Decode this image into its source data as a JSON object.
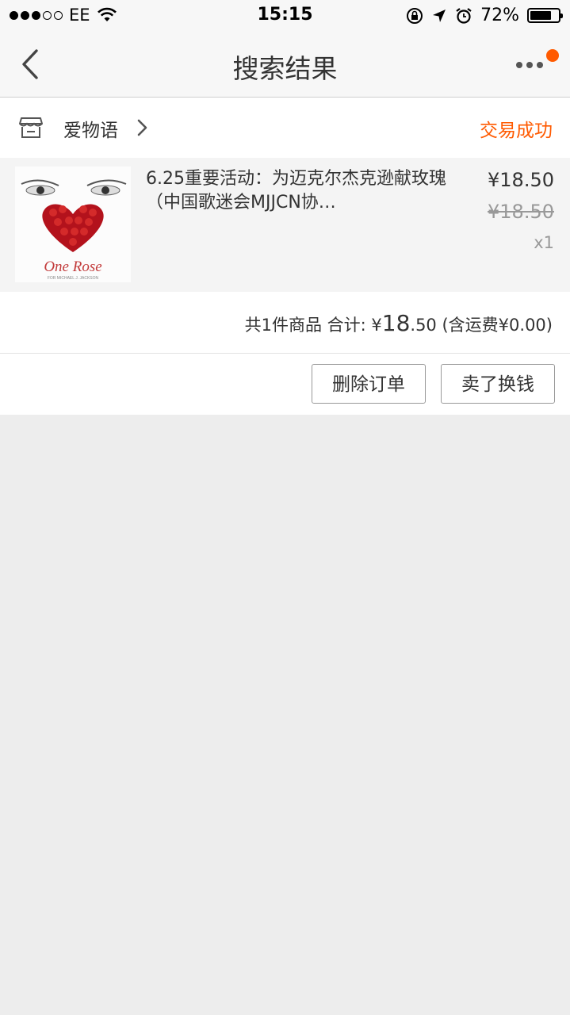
{
  "status_bar": {
    "carrier": "EE",
    "time": "15:15",
    "battery": "72%"
  },
  "nav": {
    "title": "搜索结果"
  },
  "order": {
    "shop_name": "爱物语",
    "status": "交易成功",
    "item": {
      "title": "6.25重要活动：为迈克尔杰克逊献玫瑰 （中国歌迷会MJJCN协…",
      "image_text": "One Rose",
      "image_subtext": "FOR MICHAEL J. JACKSON",
      "price": "¥18.50",
      "original_price": "¥18.50",
      "quantity": "x1"
    },
    "summary": {
      "count_text": "共1件商品 合计: ¥",
      "total_major": "18",
      "total_minor": ".50",
      "shipping_text": "(含运费¥0.00)"
    },
    "buttons": {
      "delete": "删除订单",
      "sell": "卖了换钱"
    }
  },
  "colors": {
    "accent": "#ff5a00",
    "background": "#ededed"
  },
  "icons": [
    "back-chevron-icon",
    "more-icon",
    "shop-icon",
    "chevron-right-icon",
    "wifi-icon",
    "lock-rotation-icon",
    "location-icon",
    "alarm-icon",
    "battery-icon"
  ]
}
